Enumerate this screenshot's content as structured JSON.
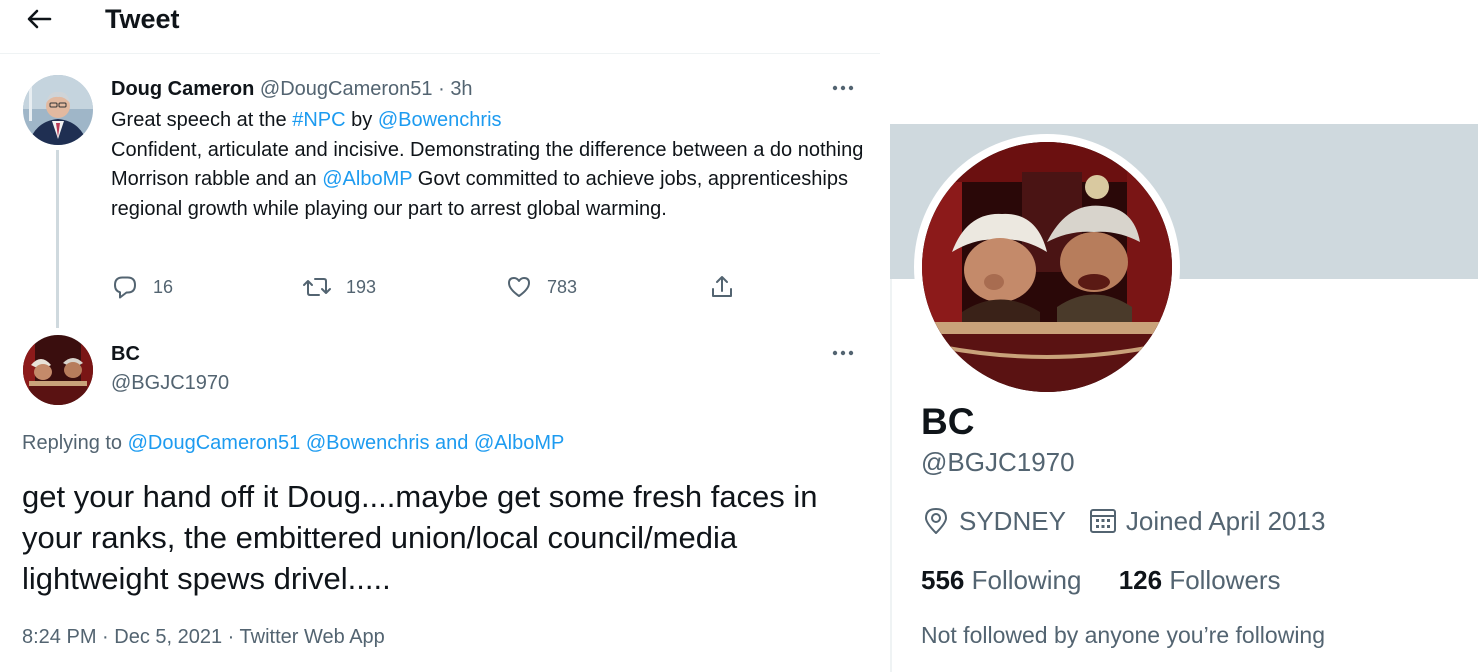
{
  "header": {
    "title": "Tweet"
  },
  "tweet_parent": {
    "author_name": "Doug Cameron",
    "author_handle": "@DougCameron51",
    "time": "3h",
    "text_1": "Great speech at the ",
    "hashtag": "#NPC",
    "text_2": " by ",
    "mention_1": "@Bowenchris",
    "text_3": "Confident, articulate and incisive. Demonstrating the difference between a do nothing Morrison rabble and an ",
    "mention_2": "@AlboMP",
    "text_4": " Govt committed to achieve jobs, apprenticeships regional growth while playing our part to arrest global warming.",
    "replies": "16",
    "retweets": "193",
    "likes": "783"
  },
  "tweet_reply": {
    "author_name": "BC",
    "author_handle": "@BGJC1970",
    "replying_prefix": "Replying to ",
    "replying_1": "@DougCameron51",
    "replying_2": "@Bowenchris",
    "replying_and": " and ",
    "replying_3": "@AlboMP",
    "text": "get your hand off it Doug....maybe get some fresh faces in your ranks, the embittered union/local council/media lightweight spews drivel.....",
    "timestamp": "8:24 PM · Dec 5, 2021 · Twitter Web App"
  },
  "profile_card": {
    "name": "BC",
    "handle": "@BGJC1970",
    "location": "SYDNEY",
    "joined": "Joined April 2013",
    "following_count": "556",
    "following_label": "Following",
    "followers_count": "126",
    "followers_label": "Followers",
    "not_followed_text": "Not followed by anyone you’re following"
  },
  "icons": {
    "back": "arrow-left-icon",
    "more": "more-horizontal-icon",
    "reply": "reply-icon",
    "retweet": "retweet-icon",
    "like": "heart-icon",
    "share": "share-icon",
    "location": "location-pin-icon",
    "calendar": "calendar-icon"
  },
  "colors": {
    "link": "#1d9bf0",
    "text_primary": "#0f1419",
    "text_secondary": "#536471",
    "banner": "#cfd9de",
    "thread_line": "#cfd9de"
  }
}
